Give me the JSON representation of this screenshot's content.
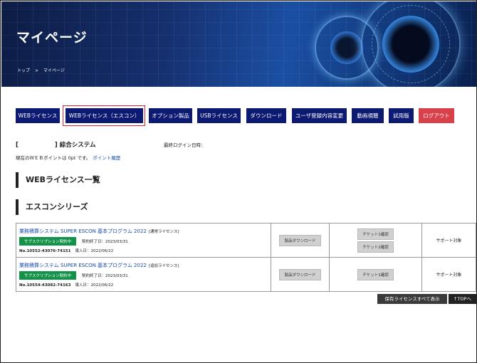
{
  "header": {
    "title": "マイページ",
    "breadcrumb": [
      "トップ",
      ">",
      "マイページ"
    ]
  },
  "nav": {
    "items": [
      {
        "label": "WEBライセンス"
      },
      {
        "label": "WEBライセンス（エスコン）"
      },
      {
        "label": "オプション製品"
      },
      {
        "label": "USBライセンス"
      },
      {
        "label": "ダウンロード"
      },
      {
        "label": "ユーザ登録内容変更"
      },
      {
        "label": "動画視聴"
      },
      {
        "label": "試用版"
      },
      {
        "label": "ログアウト"
      }
    ],
    "selected": "WEBライセンス（エスコン）"
  },
  "account": {
    "system": "[　　　　　　] 綜合システム",
    "last_login": "最終ログイン日時：",
    "points": "現在のＷＥＢポイントは 0pt です。",
    "points_link": "ポイント履歴"
  },
  "sections": {
    "web_license": "WEBライセンス一覧",
    "escon_series": "エスコンシリーズ"
  },
  "licenses": [
    {
      "name": "業務積算システム SUPER ESCON 基本プログラム 2022",
      "tag": "[通常ライセンス]",
      "status": "サブスクリプション契約中",
      "end_date": "契約終了日：2023/03/31",
      "number": "No.10552-43076-74151",
      "install": "導入日：2022/06/22",
      "download": "製品ダウンロード",
      "tickets": [
        "チケット1確認",
        "チケット2確認"
      ],
      "support": "サポート対象"
    },
    {
      "name": "業務積算システム SUPER ESCON 基本プログラム 2022",
      "tag": "[追加ライセンス]",
      "status": "サブスクリプション契約中",
      "end_date": "契約終了日：2023/03/31",
      "number": "No.10554-43082-74163",
      "install": "導入日：2022/06/22",
      "download": "製品ダウンロード",
      "tickets": [
        "チケット1確認"
      ],
      "support": "サポート対象"
    }
  ],
  "footer": {
    "show_all": "保有ライセンスすべて表示",
    "top": "TOPへ"
  },
  "colors": {
    "nav_bg": "#0c1a72",
    "logout_bg": "#d9414a",
    "highlight_border": "#d8222e",
    "subscription_badge": "#13924a",
    "link": "#1a55b8"
  }
}
